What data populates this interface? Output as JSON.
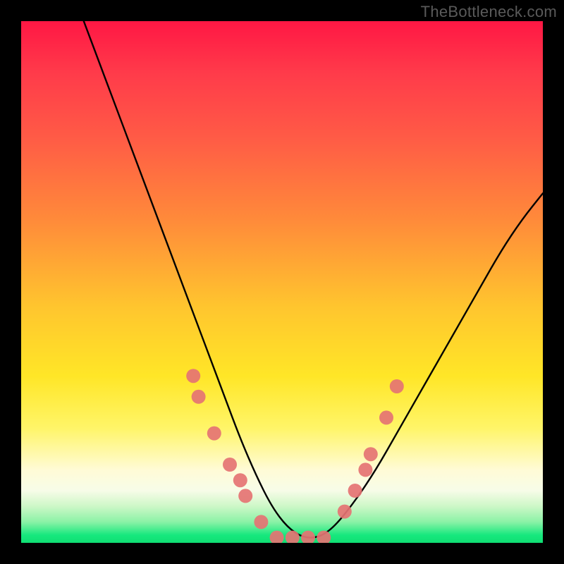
{
  "watermark": "TheBottleneck.com",
  "chart_data": {
    "type": "line",
    "title": "",
    "xlabel": "",
    "ylabel": "",
    "xlim": [
      0,
      100
    ],
    "ylim": [
      0,
      100
    ],
    "series": [
      {
        "name": "curve",
        "x": [
          12,
          15,
          18,
          21,
          24,
          27,
          30,
          33,
          36,
          39,
          42,
          45,
          48,
          51,
          54,
          57,
          60,
          64,
          68,
          72,
          76,
          80,
          84,
          88,
          92,
          96,
          100
        ],
        "y": [
          100,
          92,
          84,
          76,
          68,
          60,
          52,
          44,
          36,
          28,
          20,
          13,
          7,
          3,
          1,
          1,
          3,
          8,
          14,
          21,
          28,
          35,
          42,
          49,
          56,
          62,
          67
        ]
      }
    ],
    "markers": [
      {
        "x": 33,
        "y": 32
      },
      {
        "x": 34,
        "y": 28
      },
      {
        "x": 37,
        "y": 21
      },
      {
        "x": 40,
        "y": 15
      },
      {
        "x": 42,
        "y": 12
      },
      {
        "x": 43,
        "y": 9
      },
      {
        "x": 46,
        "y": 4
      },
      {
        "x": 49,
        "y": 1
      },
      {
        "x": 52,
        "y": 1
      },
      {
        "x": 55,
        "y": 1
      },
      {
        "x": 58,
        "y": 1
      },
      {
        "x": 62,
        "y": 6
      },
      {
        "x": 64,
        "y": 10
      },
      {
        "x": 66,
        "y": 14
      },
      {
        "x": 67,
        "y": 17
      },
      {
        "x": 70,
        "y": 24
      },
      {
        "x": 72,
        "y": 30
      }
    ],
    "marker_color": "#e57373",
    "curve_color": "#000000",
    "gradient_note": "Background encodes bottleneck severity: red=high, green=low"
  }
}
